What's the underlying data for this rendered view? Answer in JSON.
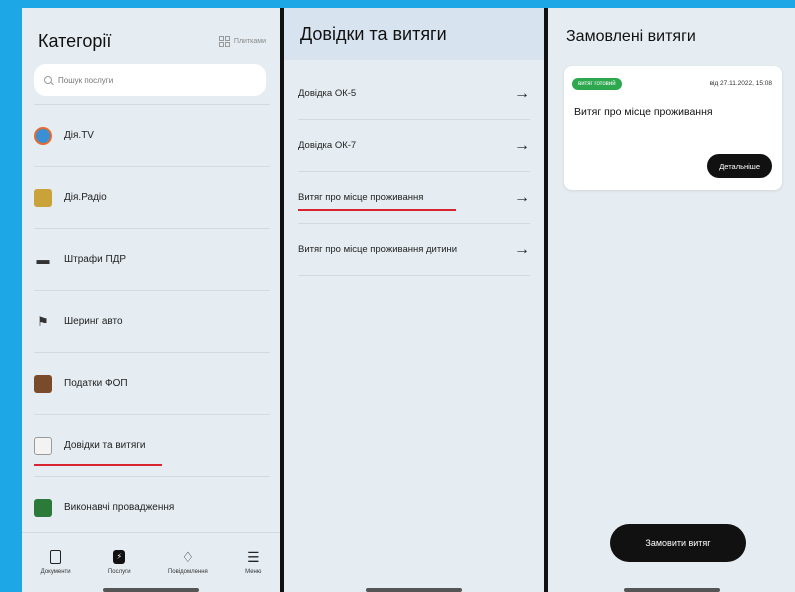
{
  "categories_panel": {
    "title": "Категорії",
    "tiles_label": "Плитками",
    "search_placeholder": "Пошук послуги",
    "items": [
      {
        "label": "Дія.TV",
        "icon": "tv-icon"
      },
      {
        "label": "Дія.Радіо",
        "icon": "radio-icon"
      },
      {
        "label": "Штрафи ПДР",
        "icon": "car-icon"
      },
      {
        "label": "Шеринг авто",
        "icon": "checkered-flag-icon"
      },
      {
        "label": "Податки ФОП",
        "icon": "briefcase-icon"
      },
      {
        "label": "Довідки та витяги",
        "icon": "document-icon"
      },
      {
        "label": "Виконавчі провадження",
        "icon": "courthouse-icon"
      }
    ],
    "tabs": [
      {
        "label": "Документи",
        "icon": "documents-icon"
      },
      {
        "label": "Послуги",
        "icon": "services-icon"
      },
      {
        "label": "Повідомлення",
        "icon": "bell-icon"
      },
      {
        "label": "Меню",
        "icon": "menu-icon"
      }
    ]
  },
  "documents_panel": {
    "title": "Довідки та витяги",
    "items": [
      {
        "label": "Довідка ОК-5"
      },
      {
        "label": "Довідка ОК-7"
      },
      {
        "label": "Витяг про місце проживання"
      },
      {
        "label": "Витяг про місце проживання дитини"
      }
    ]
  },
  "orders_panel": {
    "title": "Замовлені витяги",
    "card": {
      "badge": "витяг готовий",
      "date": "від 27.11.2022, 15:08",
      "title": "Витяг про місце проживання",
      "details_label": "Детальніше"
    },
    "order_button": "Замовити витяг"
  },
  "colors": {
    "background": "#1ea7e6",
    "panel": "#e6edf2",
    "accent_red": "#d9232e",
    "badge_green": "#2ea84f"
  }
}
